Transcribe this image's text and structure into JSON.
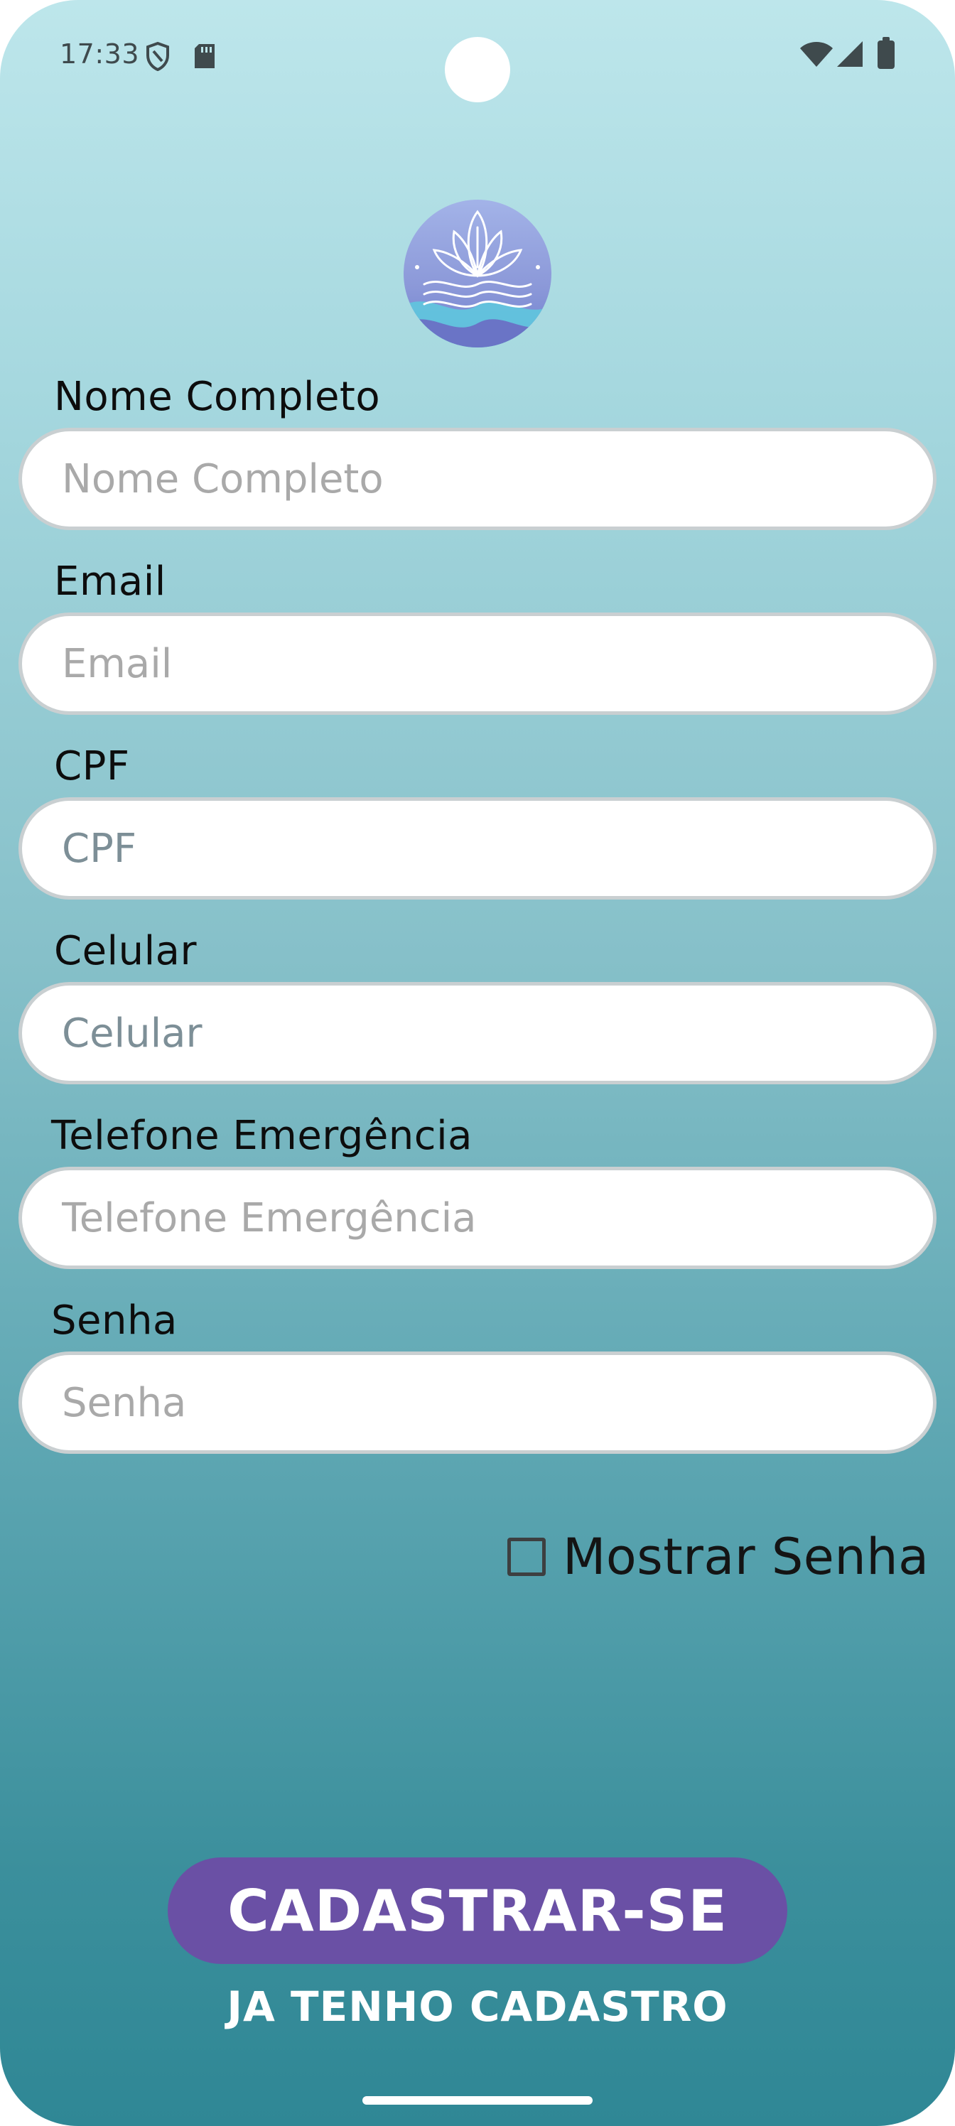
{
  "status_bar": {
    "time": "17:33",
    "icons": [
      "shield-icon",
      "sd-card-icon",
      "wifi-icon",
      "signal-icon",
      "battery-icon"
    ]
  },
  "logo": {
    "name": "lotus-waves-logo",
    "colors": [
      "#7f8fd6",
      "#a4b6e6",
      "#5fc6de"
    ]
  },
  "form": {
    "fields": [
      {
        "label": "Nome Completo",
        "placeholder": "Nome Completo",
        "value": ""
      },
      {
        "label": "Email",
        "placeholder": "Email",
        "value": ""
      },
      {
        "label": "CPF",
        "placeholder": "CPF",
        "value": ""
      },
      {
        "label": "Celular",
        "placeholder": "Celular",
        "value": ""
      },
      {
        "label": "Telefone Emergência",
        "placeholder": "Telefone Emergência",
        "value": ""
      },
      {
        "label": "Senha",
        "placeholder": "Senha",
        "value": ""
      }
    ],
    "show_password": {
      "label": "Mostrar Senha",
      "checked": false
    }
  },
  "actions": {
    "register_label": "CADASTRAR-SE",
    "login_label": "JA TENHO CADASTRO"
  },
  "colors": {
    "primary": "#6a50a5",
    "background_top": "#bde6eb",
    "background_bottom": "#2f8795"
  }
}
